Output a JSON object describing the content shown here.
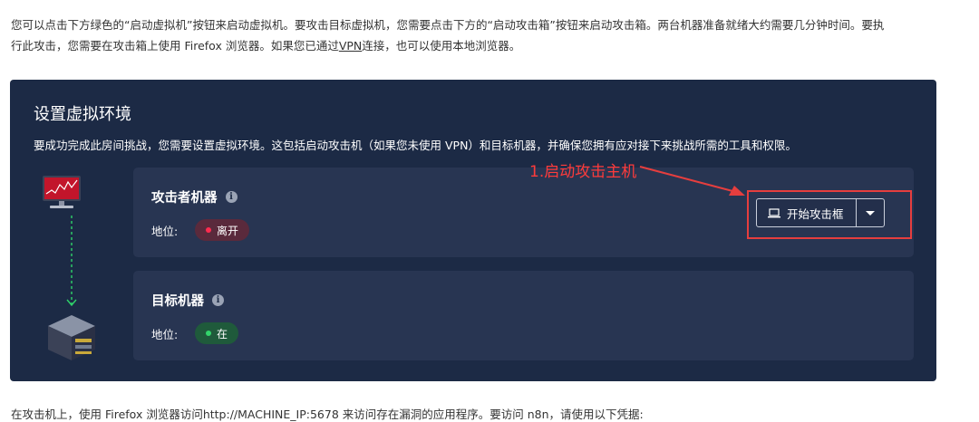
{
  "intro": {
    "line1": "您可以点击下方绿色的“启动虚拟机”按钮来启动虚拟机。要攻击目标虚拟机，您需要点击下方的“启动攻击箱”按钮来启动攻击箱。两台机器准备就绪大约需要几分钟时间。要执",
    "line2_a": "行此攻击，您需要在攻击箱上使用 Firefox 浏览器。如果您已通过",
    "line2_vpn": "VPN",
    "line2_b": "连接，也可以使用本地浏览器。"
  },
  "panel": {
    "title": "设置虚拟环境",
    "description": "要成功完成此房间挑战，您需要设置虚拟环境。这包括启动攻击机（如果您未使用 VPN）和目标机器，并确保您拥有应对接下来挑战所需的工具和权限。"
  },
  "attacker": {
    "title": "攻击者机器",
    "status_label": "地位:",
    "status": "离开",
    "button_label": "开始攻击框"
  },
  "target": {
    "title": "目标机器",
    "status_label": "地位:",
    "status": "在"
  },
  "annotation": "1.启动攻击主机",
  "bottom_text": "在攻击机上，使用 Firefox 浏览器访问http://MACHINE_IP:5678 来访问存在漏洞的应用程序。要访问 n8n，请使用以下凭据:",
  "colors": {
    "panel_bg": "#1c2a45",
    "card_bg": "#283552",
    "status_offline": "#ff2b4f",
    "status_online": "#33d46b",
    "annotation_red": "#e63e3e"
  },
  "icons": {
    "info": "info-icon",
    "laptop": "laptop-icon",
    "caret": "chevron-down-icon",
    "monitor": "monitor-icon",
    "server": "server-icon"
  }
}
